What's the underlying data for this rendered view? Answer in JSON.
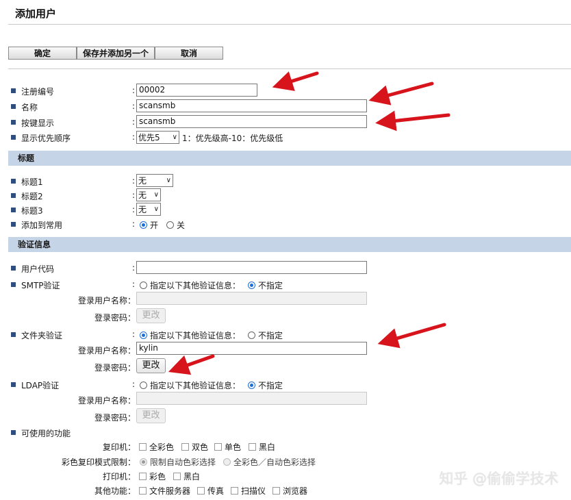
{
  "page": {
    "title": "添加用户"
  },
  "toolbar": {
    "ok": "确定",
    "save_add": "保存并添加另一个",
    "cancel": "取消"
  },
  "fields": {
    "reg_no": {
      "label": "注册编号",
      "value": "00002"
    },
    "name": {
      "label": "名称",
      "value": "scansmb"
    },
    "key_display": {
      "label": "按键显示",
      "value": "scansmb"
    },
    "priority": {
      "label": "显示优先顺序",
      "value": "优先5",
      "hint": "1：优先级高-10：优先级低"
    }
  },
  "title_section": {
    "header": "标题",
    "title1": {
      "label": "标题1",
      "value": "无"
    },
    "title2": {
      "label": "标题2",
      "value": "无"
    },
    "title3": {
      "label": "标题3",
      "value": "无"
    },
    "add_common": {
      "label": "添加到常用",
      "on": "开",
      "off": "关",
      "selected": "开"
    }
  },
  "auth": {
    "header": "验证信息",
    "user_code": {
      "label": "用户代码",
      "value": ""
    },
    "smtp": {
      "label": "SMTP验证",
      "specify": "指定以下其他验证信息：",
      "not_specify": "不指定",
      "selected": "不指定",
      "login_user_label": "登录用户名称：",
      "login_pw_label": "登录密码：",
      "change": "更改"
    },
    "folder": {
      "label": "文件夹验证",
      "specify": "指定以下其他验证信息：",
      "not_specify": "不指定",
      "selected": "指定以下其他验证信息：",
      "login_user_label": "登录用户名称：",
      "login_user_value": "kylin",
      "login_pw_label": "登录密码：",
      "change": "更改"
    },
    "ldap": {
      "label": "LDAP验证",
      "specify": "指定以下其他验证信息：",
      "not_specify": "不指定",
      "selected": "不指定",
      "login_user_label": "登录用户名称：",
      "login_pw_label": "登录密码：",
      "change": "更改"
    }
  },
  "functions": {
    "label": "可使用的功能",
    "copier": {
      "label": "复印机：",
      "options": [
        "全彩色",
        "双色",
        "单色",
        "黑白"
      ]
    },
    "color_copy_limit": {
      "label": "彩色复印模式限制：",
      "options": [
        "限制自动色彩选择",
        "全彩色／自动色彩选择"
      ],
      "selected": "限制自动色彩选择"
    },
    "printer": {
      "label": "打印机：",
      "options": [
        "彩色",
        "黑白"
      ]
    },
    "other": {
      "label": "其他功能：",
      "options": [
        "文件服务器",
        "传真",
        "扫描仪",
        "浏览器"
      ]
    }
  },
  "watermark": "知乎 @偷偷学技术",
  "colors": {
    "section_bg": "#c5d4e6",
    "bullet": "#2f4e7e",
    "arrow": "#d7141c",
    "radio_on": "#1a6fd8"
  }
}
